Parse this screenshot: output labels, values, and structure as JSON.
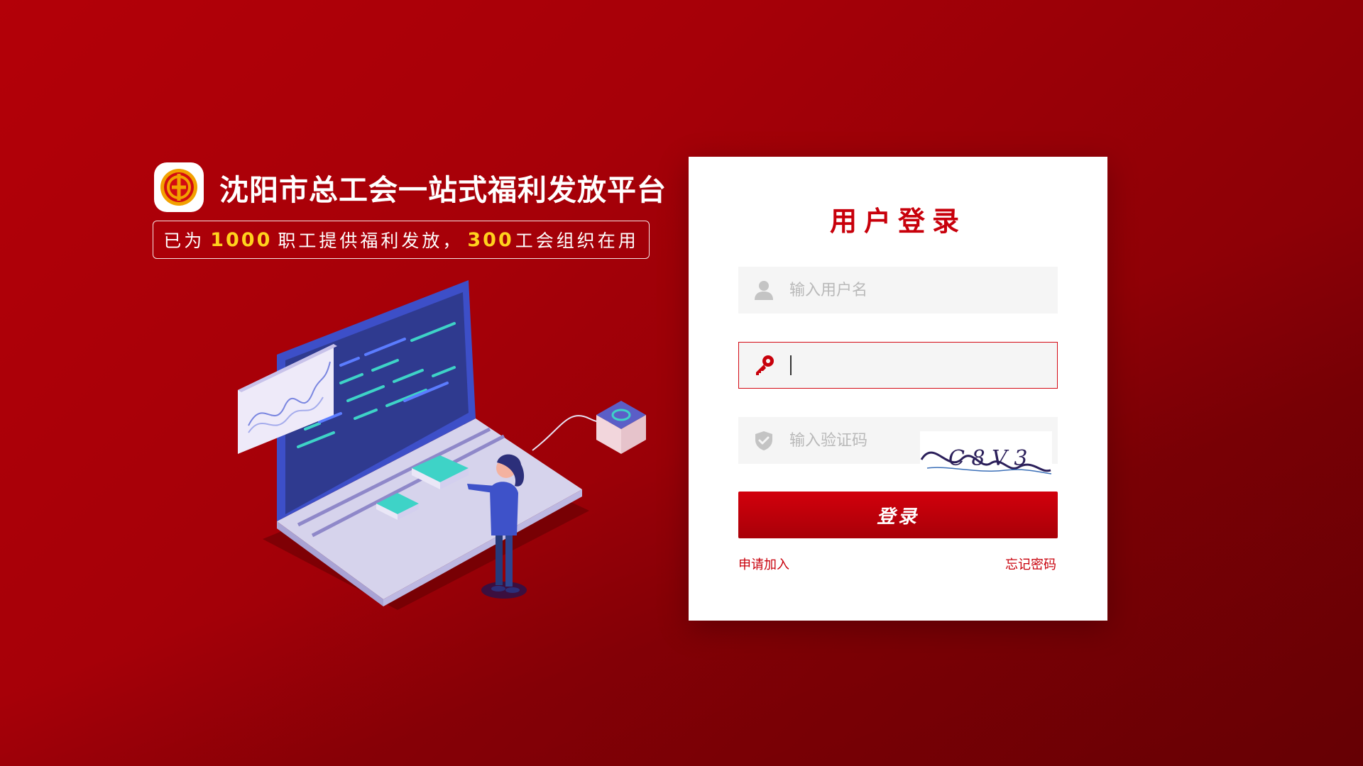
{
  "brand": {
    "title": "沈阳市总工会一站式福利发放平台",
    "stats_prefix": "已为",
    "workers_count": "1000",
    "stats_middle": "职工提供福利发放，",
    "unions_count": "300",
    "stats_suffix": "工会组织在用"
  },
  "login": {
    "title": "用户登录",
    "username_placeholder": "输入用户名",
    "password_value": "",
    "captcha_placeholder": "输入验证码",
    "captcha_text": "C 8 V 3",
    "submit_label": "登录",
    "apply_link": "申请加入",
    "forgot_link": "忘记密码"
  },
  "icons": {
    "logo": "union-logo-icon",
    "username": "user-icon",
    "password": "key-icon",
    "captcha": "shield-icon"
  },
  "colors": {
    "primary_red": "#c8000b",
    "highlight_yellow": "#ffd21d",
    "background_red": "#a60008"
  }
}
